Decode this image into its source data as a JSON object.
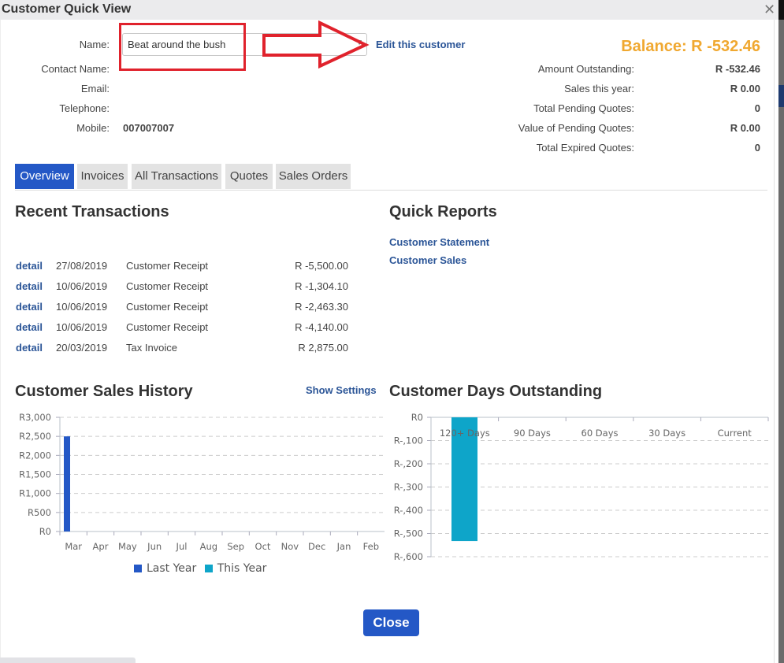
{
  "dialog": {
    "title": "Customer Quick View",
    "close_icon": "close-icon",
    "close_button_label": "Close"
  },
  "customer": {
    "name_label": "Name:",
    "name_value": "Beat around the bush",
    "contact_label": "Contact Name:",
    "contact_value": "",
    "email_label": "Email:",
    "email_value": "",
    "telephone_label": "Telephone:",
    "telephone_value": "",
    "mobile_label": "Mobile:",
    "mobile_value": "007007007",
    "edit_link": "Edit this customer"
  },
  "summary": {
    "balance": "Balance: R -532.46",
    "items": [
      {
        "label": "Amount Outstanding:",
        "value": "R -532.46"
      },
      {
        "label": "Sales this year:",
        "value": "R 0.00"
      },
      {
        "label": "Total Pending Quotes:",
        "value": "0"
      },
      {
        "label": "Value of Pending Quotes:",
        "value": "R 0.00"
      },
      {
        "label": "Total Expired Quotes:",
        "value": "0"
      }
    ]
  },
  "tabs": [
    {
      "label": "Overview",
      "active": true
    },
    {
      "label": "Invoices",
      "active": false
    },
    {
      "label": "All Transactions",
      "active": false
    },
    {
      "label": "Quotes",
      "active": false
    },
    {
      "label": "Sales Orders",
      "active": false
    }
  ],
  "recent_transactions": {
    "title": "Recent Transactions",
    "rows": [
      {
        "link": "detail",
        "date": "27/08/2019",
        "type": "Customer Receipt",
        "amount": "R -5,500.00"
      },
      {
        "link": "detail",
        "date": "10/06/2019",
        "type": "Customer Receipt",
        "amount": "R -1,304.10"
      },
      {
        "link": "detail",
        "date": "10/06/2019",
        "type": "Customer Receipt",
        "amount": "R -2,463.30"
      },
      {
        "link": "detail",
        "date": "10/06/2019",
        "type": "Customer Receipt",
        "amount": "R -4,140.00"
      },
      {
        "link": "detail",
        "date": "20/03/2019",
        "type": "Tax Invoice",
        "amount": "R 2,875.00"
      }
    ]
  },
  "quick_reports": {
    "title": "Quick Reports",
    "links": [
      "Customer Statement",
      "Customer Sales"
    ]
  },
  "sales_history": {
    "title": "Customer Sales History",
    "settings_link": "Show Settings"
  },
  "days_outstanding": {
    "title": "Customer Days Outstanding"
  },
  "colors": {
    "accent": "#2458c6",
    "balance": "#f0a830",
    "last_year": "#2458c6",
    "this_year": "#0ea5c9",
    "annotation": "#e0222c"
  },
  "chart_data": [
    {
      "type": "bar",
      "title": "Customer Sales History",
      "categories": [
        "Mar",
        "Apr",
        "May",
        "Jun",
        "Jul",
        "Aug",
        "Sep",
        "Oct",
        "Nov",
        "Dec",
        "Jan",
        "Feb"
      ],
      "series": [
        {
          "name": "Last Year",
          "values": [
            2500,
            0,
            0,
            0,
            0,
            0,
            0,
            0,
            0,
            0,
            0,
            0
          ]
        },
        {
          "name": "This Year",
          "values": [
            0,
            0,
            0,
            0,
            0,
            0,
            0,
            0,
            0,
            0,
            0,
            0
          ]
        }
      ],
      "yticks": [
        "R0",
        "R500",
        "R1,000",
        "R1,500",
        "R2,000",
        "R2,500",
        "R3,000"
      ],
      "ylim": [
        0,
        3000
      ],
      "grid": true,
      "legend": "bottom"
    },
    {
      "type": "bar",
      "title": "Customer Days Outstanding",
      "categories": [
        "120+ Days",
        "90 Days",
        "60 Days",
        "30 Days",
        "Current"
      ],
      "values": [
        -532.46,
        0,
        0,
        0,
        0
      ],
      "yticks": [
        "R0",
        "R-,100",
        "R-,200",
        "R-,300",
        "R-,400",
        "R-,500",
        "R-,600"
      ],
      "ylim": [
        -600,
        0
      ],
      "grid": true
    }
  ]
}
